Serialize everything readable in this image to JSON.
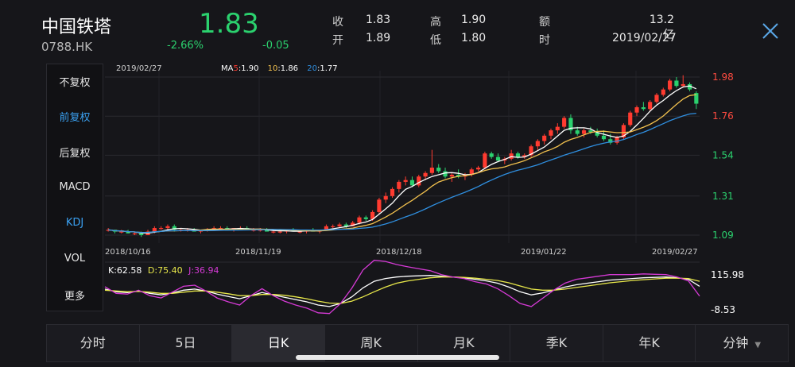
{
  "header": {
    "name": "中国铁塔",
    "code": "0788.HK",
    "price": "1.83",
    "change_pct": "-2.66%",
    "change": "-0.05",
    "quote": [
      {
        "label": "收",
        "value": "1.83"
      },
      {
        "label": "高",
        "value": "1.90"
      },
      {
        "label": "额",
        "value": "13.2亿"
      },
      {
        "label": "开",
        "value": "1.89"
      },
      {
        "label": "低",
        "value": "1.80"
      },
      {
        "label": "时",
        "value": "2019/02/27"
      }
    ]
  },
  "sidebar": {
    "items": [
      {
        "label": "不复权",
        "active": false
      },
      {
        "label": "前复权",
        "active": true
      },
      {
        "label": "后复权",
        "active": false
      },
      {
        "label": "MACD",
        "active": false
      },
      {
        "label": "KDJ",
        "active": true
      },
      {
        "label": "VOL",
        "active": false
      },
      {
        "label": "更多",
        "active": false
      }
    ]
  },
  "tabs": [
    {
      "label": "分时",
      "active": false
    },
    {
      "label": "5日",
      "active": false
    },
    {
      "label": "日K",
      "active": true
    },
    {
      "label": "周K",
      "active": false
    },
    {
      "label": "月K",
      "active": false
    },
    {
      "label": "季K",
      "active": false
    },
    {
      "label": "年K",
      "active": false
    },
    {
      "label": "分钟",
      "active": false,
      "dropdown": true
    }
  ],
  "colors": {
    "up": "#ff3b30",
    "down": "#2bd16e",
    "ma5": "#ffffff",
    "ma10": "#f2c14e",
    "ma20": "#2f8fe0",
    "k": "#ffffff",
    "d": "#e8e84a",
    "j": "#d63ad6"
  },
  "chart_data": [
    {
      "type": "candlestick",
      "top_date": "2019/02/27",
      "legend": {
        "ma5_prefix": "MA",
        "ma5_key": "5",
        "ma5_val": ":1.90",
        "ma10_key": "10",
        "ma10_val": ":1.86",
        "ma20_key": "20",
        "ma20_val": ":1.77"
      },
      "ylim": [
        1.09,
        1.98
      ],
      "y_ticks": [
        "1.98",
        "1.76",
        "1.54",
        "1.31",
        "1.09"
      ],
      "x_ticks": [
        "2018/10/16",
        "2018/11/19",
        "2018/12/18",
        "2019/01/22",
        "2019/02/27"
      ],
      "ohlc": [
        [
          1.12,
          1.13,
          1.11,
          1.12
        ],
        [
          1.12,
          1.12,
          1.1,
          1.11
        ],
        [
          1.11,
          1.12,
          1.1,
          1.11
        ],
        [
          1.11,
          1.12,
          1.1,
          1.1
        ],
        [
          1.1,
          1.11,
          1.09,
          1.1
        ],
        [
          1.1,
          1.11,
          1.08,
          1.09
        ],
        [
          1.09,
          1.12,
          1.09,
          1.11
        ],
        [
          1.11,
          1.14,
          1.1,
          1.13
        ],
        [
          1.13,
          1.14,
          1.12,
          1.13
        ],
        [
          1.13,
          1.15,
          1.12,
          1.14
        ],
        [
          1.14,
          1.15,
          1.11,
          1.12
        ],
        [
          1.12,
          1.13,
          1.11,
          1.12
        ],
        [
          1.12,
          1.13,
          1.11,
          1.12
        ],
        [
          1.12,
          1.13,
          1.11,
          1.11
        ],
        [
          1.11,
          1.12,
          1.1,
          1.12
        ],
        [
          1.12,
          1.13,
          1.11,
          1.12
        ],
        [
          1.12,
          1.14,
          1.12,
          1.13
        ],
        [
          1.13,
          1.14,
          1.12,
          1.13
        ],
        [
          1.13,
          1.14,
          1.12,
          1.12
        ],
        [
          1.12,
          1.13,
          1.11,
          1.13
        ],
        [
          1.13,
          1.14,
          1.12,
          1.13
        ],
        [
          1.13,
          1.14,
          1.12,
          1.12
        ],
        [
          1.12,
          1.13,
          1.11,
          1.12
        ],
        [
          1.12,
          1.13,
          1.11,
          1.12
        ],
        [
          1.12,
          1.13,
          1.11,
          1.11
        ],
        [
          1.11,
          1.12,
          1.1,
          1.11
        ],
        [
          1.11,
          1.12,
          1.1,
          1.11
        ],
        [
          1.11,
          1.12,
          1.1,
          1.12
        ],
        [
          1.12,
          1.13,
          1.11,
          1.11
        ],
        [
          1.11,
          1.12,
          1.1,
          1.11
        ],
        [
          1.11,
          1.12,
          1.1,
          1.12
        ],
        [
          1.12,
          1.13,
          1.11,
          1.11
        ],
        [
          1.11,
          1.12,
          1.1,
          1.12
        ],
        [
          1.12,
          1.15,
          1.12,
          1.14
        ],
        [
          1.14,
          1.15,
          1.13,
          1.14
        ],
        [
          1.14,
          1.16,
          1.13,
          1.15
        ],
        [
          1.15,
          1.16,
          1.13,
          1.14
        ],
        [
          1.14,
          1.17,
          1.14,
          1.16
        ],
        [
          1.16,
          1.2,
          1.15,
          1.19
        ],
        [
          1.19,
          1.2,
          1.17,
          1.18
        ],
        [
          1.18,
          1.23,
          1.17,
          1.22
        ],
        [
          1.22,
          1.3,
          1.21,
          1.29
        ],
        [
          1.29,
          1.33,
          1.27,
          1.31
        ],
        [
          1.31,
          1.36,
          1.3,
          1.35
        ],
        [
          1.35,
          1.4,
          1.33,
          1.39
        ],
        [
          1.39,
          1.42,
          1.37,
          1.4
        ],
        [
          1.4,
          1.42,
          1.36,
          1.37
        ],
        [
          1.37,
          1.43,
          1.36,
          1.42
        ],
        [
          1.42,
          1.45,
          1.4,
          1.44
        ],
        [
          1.44,
          1.57,
          1.43,
          1.47
        ],
        [
          1.47,
          1.49,
          1.44,
          1.45
        ],
        [
          1.45,
          1.47,
          1.41,
          1.42
        ],
        [
          1.42,
          1.44,
          1.39,
          1.43
        ],
        [
          1.43,
          1.46,
          1.41,
          1.42
        ],
        [
          1.42,
          1.44,
          1.4,
          1.43
        ],
        [
          1.43,
          1.47,
          1.42,
          1.46
        ],
        [
          1.46,
          1.48,
          1.45,
          1.47
        ],
        [
          1.47,
          1.56,
          1.46,
          1.55
        ],
        [
          1.55,
          1.56,
          1.52,
          1.53
        ],
        [
          1.53,
          1.55,
          1.5,
          1.51
        ],
        [
          1.51,
          1.53,
          1.49,
          1.52
        ],
        [
          1.52,
          1.57,
          1.51,
          1.55
        ],
        [
          1.55,
          1.56,
          1.52,
          1.53
        ],
        [
          1.53,
          1.55,
          1.52,
          1.54
        ],
        [
          1.54,
          1.6,
          1.53,
          1.59
        ],
        [
          1.59,
          1.63,
          1.57,
          1.62
        ],
        [
          1.62,
          1.66,
          1.6,
          1.65
        ],
        [
          1.65,
          1.69,
          1.63,
          1.68
        ],
        [
          1.68,
          1.72,
          1.66,
          1.7
        ],
        [
          1.7,
          1.76,
          1.69,
          1.75
        ],
        [
          1.75,
          1.77,
          1.66,
          1.68
        ],
        [
          1.68,
          1.7,
          1.65,
          1.66
        ],
        [
          1.66,
          1.69,
          1.64,
          1.68
        ],
        [
          1.68,
          1.7,
          1.66,
          1.67
        ],
        [
          1.67,
          1.69,
          1.64,
          1.65
        ],
        [
          1.65,
          1.68,
          1.62,
          1.63
        ],
        [
          1.63,
          1.66,
          1.6,
          1.61
        ],
        [
          1.61,
          1.65,
          1.6,
          1.64
        ],
        [
          1.64,
          1.72,
          1.63,
          1.71
        ],
        [
          1.71,
          1.79,
          1.7,
          1.78
        ],
        [
          1.78,
          1.82,
          1.76,
          1.81
        ],
        [
          1.81,
          1.84,
          1.79,
          1.8
        ],
        [
          1.8,
          1.85,
          1.79,
          1.84
        ],
        [
          1.84,
          1.89,
          1.83,
          1.88
        ],
        [
          1.88,
          1.92,
          1.87,
          1.91
        ],
        [
          1.91,
          1.97,
          1.9,
          1.96
        ],
        [
          1.96,
          1.98,
          1.92,
          1.93
        ],
        [
          1.93,
          1.99,
          1.92,
          1.94
        ],
        [
          1.94,
          1.95,
          1.9,
          1.91
        ],
        [
          1.89,
          1.9,
          1.8,
          1.83
        ]
      ]
    },
    {
      "type": "line",
      "name": "KDJ",
      "legend": {
        "k": "K:62.58",
        "d": "D:75.40",
        "j": "J:36.94"
      },
      "y_ticks": [
        "115.98",
        "-8.53"
      ],
      "ylim": [
        -8.53,
        115.98
      ],
      "series": [
        {
          "name": "K",
          "values": [
            55,
            48,
            46,
            50,
            44,
            40,
            45,
            52,
            55,
            50,
            42,
            36,
            30,
            38,
            46,
            40,
            34,
            28,
            22,
            14,
            10,
            18,
            35,
            58,
            75,
            82,
            86,
            88,
            89,
            90,
            88,
            86,
            84,
            80,
            76,
            70,
            60,
            48,
            40,
            45,
            52,
            60,
            66,
            70,
            74,
            78,
            80,
            82,
            84,
            85,
            86,
            84,
            80,
            62
          ]
        },
        {
          "name": "D",
          "values": [
            52,
            50,
            48,
            49,
            47,
            44,
            44,
            47,
            50,
            50,
            47,
            43,
            38,
            38,
            41,
            41,
            39,
            35,
            30,
            24,
            19,
            18,
            24,
            35,
            48,
            60,
            70,
            76,
            80,
            84,
            86,
            86,
            85,
            83,
            80,
            77,
            71,
            63,
            55,
            52,
            52,
            55,
            59,
            63,
            67,
            71,
            74,
            77,
            79,
            81,
            83,
            83,
            82,
            75
          ]
        },
        {
          "name": "J",
          "values": [
            61,
            44,
            42,
            52,
            38,
            32,
            47,
            62,
            65,
            50,
            32,
            22,
            14,
            38,
            56,
            38,
            24,
            14,
            6,
            -6,
            -8,
            18,
            57,
            104,
            129,
            126,
            118,
            112,
            107,
            102,
            92,
            86,
            82,
            74,
            68,
            56,
            38,
            18,
            10,
            31,
            52,
            70,
            80,
            84,
            88,
            92,
            92,
            92,
            94,
            93,
            92,
            86,
            76,
            37
          ]
        }
      ]
    }
  ]
}
